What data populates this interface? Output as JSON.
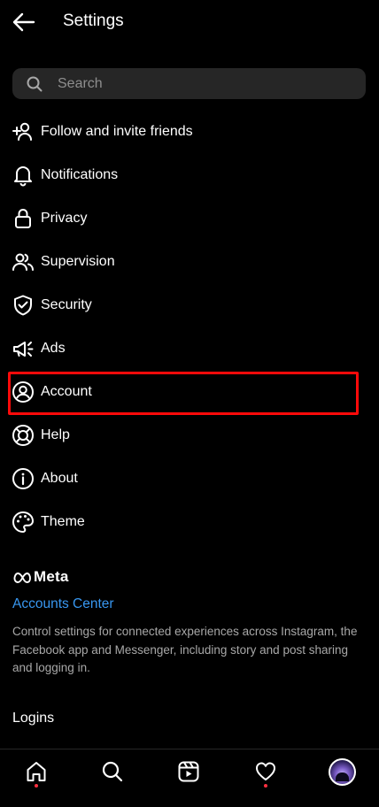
{
  "header": {
    "title": "Settings"
  },
  "search": {
    "placeholder": "Search",
    "value": ""
  },
  "menu": {
    "items": [
      {
        "label": "Follow and invite friends",
        "icon": "add-person-icon"
      },
      {
        "label": "Notifications",
        "icon": "bell-icon"
      },
      {
        "label": "Privacy",
        "icon": "lock-icon"
      },
      {
        "label": "Supervision",
        "icon": "people-icon"
      },
      {
        "label": "Security",
        "icon": "shield-check-icon"
      },
      {
        "label": "Ads",
        "icon": "megaphone-icon"
      },
      {
        "label": "Account",
        "icon": "account-circle-icon"
      },
      {
        "label": "Help",
        "icon": "lifebuoy-icon"
      },
      {
        "label": "About",
        "icon": "info-icon"
      },
      {
        "label": "Theme",
        "icon": "palette-icon"
      }
    ],
    "highlighted": "Account",
    "highlight_color": "#ff0a0a"
  },
  "meta": {
    "brand": "Meta",
    "accounts_center": "Accounts Center",
    "description": "Control settings for connected experiences across Instagram, the Facebook app and Messenger, including story and post sharing and logging in."
  },
  "logins": {
    "label": "Logins"
  },
  "bottom_nav": {
    "items": [
      "home-icon",
      "search-icon",
      "reels-icon",
      "heart-icon",
      "profile-avatar"
    ],
    "notification_dot_color": "#ff3040"
  },
  "colors": {
    "background": "#000000",
    "link": "#3897f0",
    "search_bg": "#262626",
    "muted_text": "#a8a8a8"
  }
}
